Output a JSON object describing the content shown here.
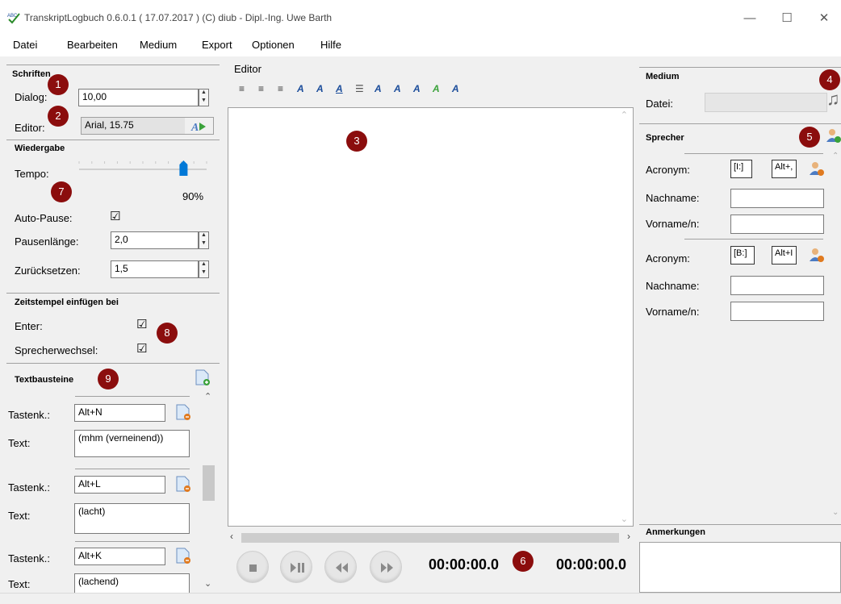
{
  "window": {
    "title": "TranskriptLogbuch 0.6.0.1  ( 17.07.2017 ) (C)  diub - Dipl.-Ing. Uwe Barth",
    "minimize": "—",
    "maximize": "☐",
    "close": "✕"
  },
  "menu": {
    "datei": "Datei",
    "bearbeiten": "Bearbeiten",
    "medium": "Medium",
    "export": "Export",
    "optionen": "Optionen",
    "hilfe": "Hilfe"
  },
  "schriften": {
    "title": "Schriften",
    "dialog_label": "Dialog:",
    "dialog_value": "10,00",
    "editor_label": "Editor:",
    "editor_value": "Arial, 15.75"
  },
  "wiedergabe": {
    "title": "Wiedergabe",
    "tempo_label": "Tempo:",
    "tempo_value": "90%",
    "tempo_fraction": 0.9,
    "autopause_label": "Auto-Pause:",
    "autopause_checked": "☑",
    "pausenlaenge_label": "Pausenlänge:",
    "pausenlaenge_value": "2,0",
    "zuruecksetzen_label": "Zurücksetzen:",
    "zuruecksetzen_value": "1,5"
  },
  "zeitstempel": {
    "title": "Zeitstempel einfügen bei",
    "enter_label": "Enter:",
    "enter_checked": "☑",
    "sprecherwechsel_label": "Sprecherwechsel:",
    "sprecherwechsel_checked": "☑"
  },
  "textbausteine": {
    "title": "Textbausteine",
    "tastenk_label": "Tastenk.:",
    "text_label": "Text:",
    "items": [
      {
        "key": "Alt+N",
        "text": "(mhm (verneinend))"
      },
      {
        "key": "Alt+L",
        "text": "(lacht)"
      },
      {
        "key": "Alt+K",
        "text": "(lachend)"
      }
    ]
  },
  "editor": {
    "title": "Editor",
    "toolbar": [
      "≡",
      "≡",
      "≡",
      "A",
      "A",
      "A",
      "☰",
      "A",
      "A",
      "A",
      "A",
      "A"
    ]
  },
  "player": {
    "time_current": "00:00:00.0",
    "time_total": "00:00:00.0"
  },
  "medium": {
    "title": "Medium",
    "datei_label": "Datei:"
  },
  "sprecher": {
    "title": "Sprecher",
    "acronym_label": "Acronym:",
    "nachname_label": "Nachname:",
    "vorname_label": "Vorname/n:",
    "speakers": [
      {
        "acronym": "[I:]",
        "shortcut": "Alt+,"
      },
      {
        "acronym": "[B:]",
        "shortcut": "Alt+I"
      }
    ]
  },
  "anmerkungen": {
    "title": "Anmerkungen"
  },
  "badges": [
    "1",
    "2",
    "3",
    "4",
    "5",
    "6",
    "7",
    "8",
    "9"
  ]
}
